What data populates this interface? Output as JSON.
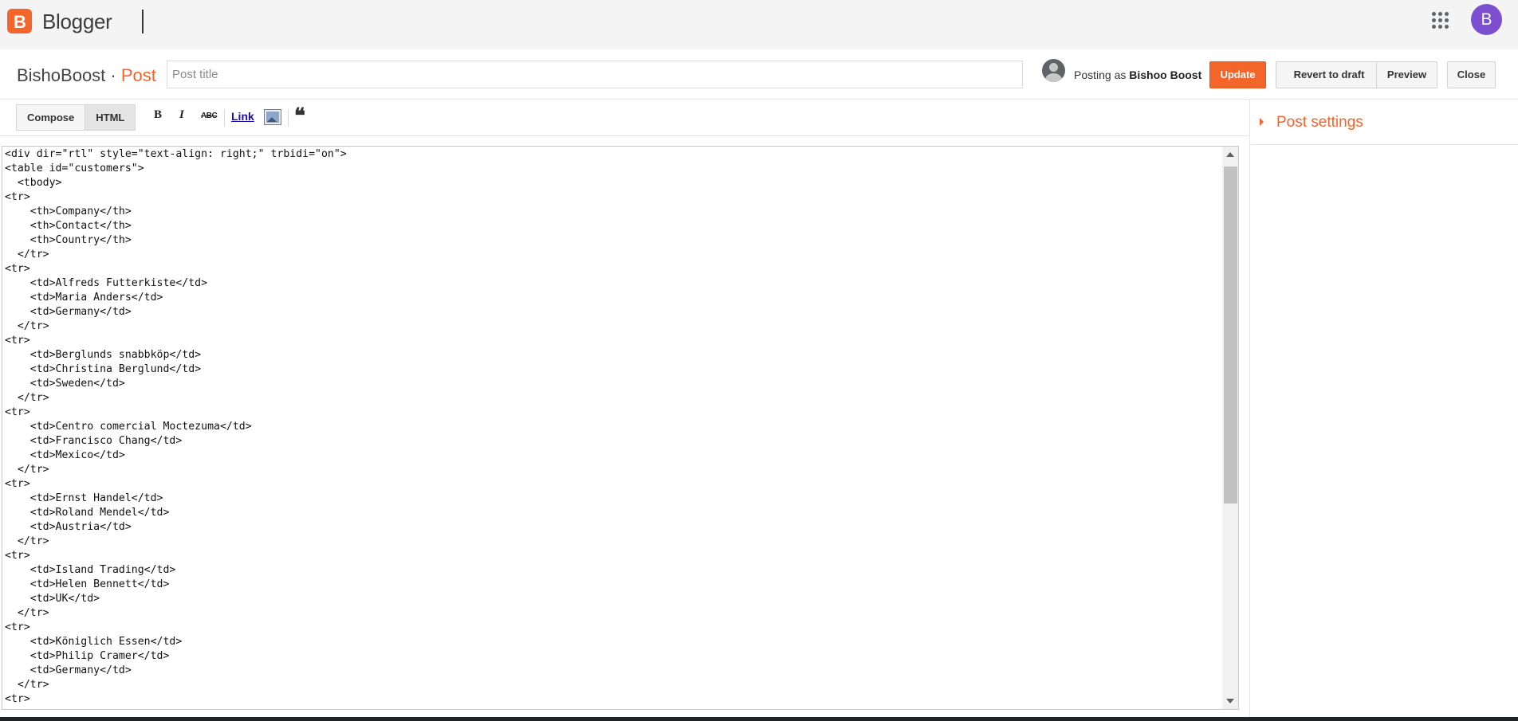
{
  "appbar": {
    "app_name": "Blogger",
    "logo_letter": "B",
    "account_initial": "B"
  },
  "header": {
    "blog_name": "BishoBoost",
    "separator": " · ",
    "crumb": "Post",
    "title_placeholder": "Post title",
    "title_value": "",
    "posting_as_prefix": "Posting as",
    "posting_as_name": "Bishoo Boost",
    "buttons": {
      "update": "Update",
      "revert": "Revert to draft",
      "preview": "Preview",
      "close": "Close"
    }
  },
  "toolbar": {
    "compose_label": "Compose",
    "html_label": "HTML",
    "active_mode": "HTML",
    "bold": "B",
    "italic": "I",
    "strikethrough": "ABC",
    "link": "Link",
    "quote": "❝"
  },
  "editor": {
    "code": "<div dir=\"rtl\" style=\"text-align: right;\" trbidi=\"on\">\n<table id=\"customers\">\n  <tbody>\n<tr>\n    <th>Company</th>\n    <th>Contact</th>\n    <th>Country</th>\n  </tr>\n<tr>\n    <td>Alfreds Futterkiste</td>\n    <td>Maria Anders</td>\n    <td>Germany</td>\n  </tr>\n<tr>\n    <td>Berglunds snabbköp</td>\n    <td>Christina Berglund</td>\n    <td>Sweden</td>\n  </tr>\n<tr>\n    <td>Centro comercial Moctezuma</td>\n    <td>Francisco Chang</td>\n    <td>Mexico</td>\n  </tr>\n<tr>\n    <td>Ernst Handel</td>\n    <td>Roland Mendel</td>\n    <td>Austria</td>\n  </tr>\n<tr>\n    <td>Island Trading</td>\n    <td>Helen Bennett</td>\n    <td>UK</td>\n  </tr>\n<tr>\n    <td>Königlich Essen</td>\n    <td>Philip Cramer</td>\n    <td>Germany</td>\n  </tr>\n<tr>"
  },
  "settings": {
    "title": "Post settings"
  },
  "colors": {
    "accent": "#f4652a",
    "account_avatar": "#7b4fcf"
  },
  "icons": {
    "logo": "blogger-logo-icon",
    "apps": "apps-grid-icon",
    "image": "insert-image-icon",
    "quote": "quote-icon",
    "caret": "caret-right-icon"
  }
}
